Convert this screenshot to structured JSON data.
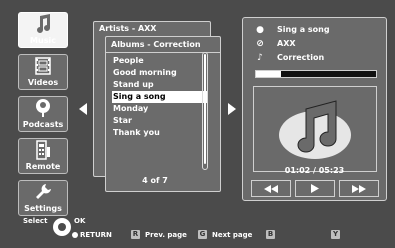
{
  "nav": {
    "items": [
      {
        "label": "Music",
        "icon": "music-note-icon",
        "active": true
      },
      {
        "label": "Videos",
        "icon": "film-icon",
        "active": false
      },
      {
        "label": "Podcasts",
        "icon": "podcast-icon",
        "active": false
      },
      {
        "label": "Remote",
        "icon": "remote-icon",
        "active": false
      },
      {
        "label": "Settings",
        "icon": "wrench-icon",
        "active": false
      }
    ]
  },
  "browser": {
    "back_title": "Artists - AXX",
    "front_title": "Albums - Correction",
    "songs": [
      "People",
      "Good morning",
      "Stand up",
      "Sing a song",
      "Monday",
      "Star",
      "Thank you"
    ],
    "selected_index": 3,
    "page_info": "4 of 7"
  },
  "nowplaying": {
    "song": "Sing a song",
    "artist": "AXX",
    "album": "Correction",
    "progress": 0.21,
    "time": "01:02 / 05:23",
    "controls": [
      "previous",
      "play",
      "next"
    ]
  },
  "legend": {
    "select_label": "Select",
    "ok_label": "OK",
    "return_label": "RETURN",
    "r_key": "R",
    "r_label": "Prev. page",
    "g_key": "G",
    "g_label": "Next page",
    "b_key": "B",
    "y_key": "Y"
  },
  "colors": {
    "background": "#4b4b4b",
    "panel": "#6a6a6a",
    "highlight": "#ffffff"
  }
}
